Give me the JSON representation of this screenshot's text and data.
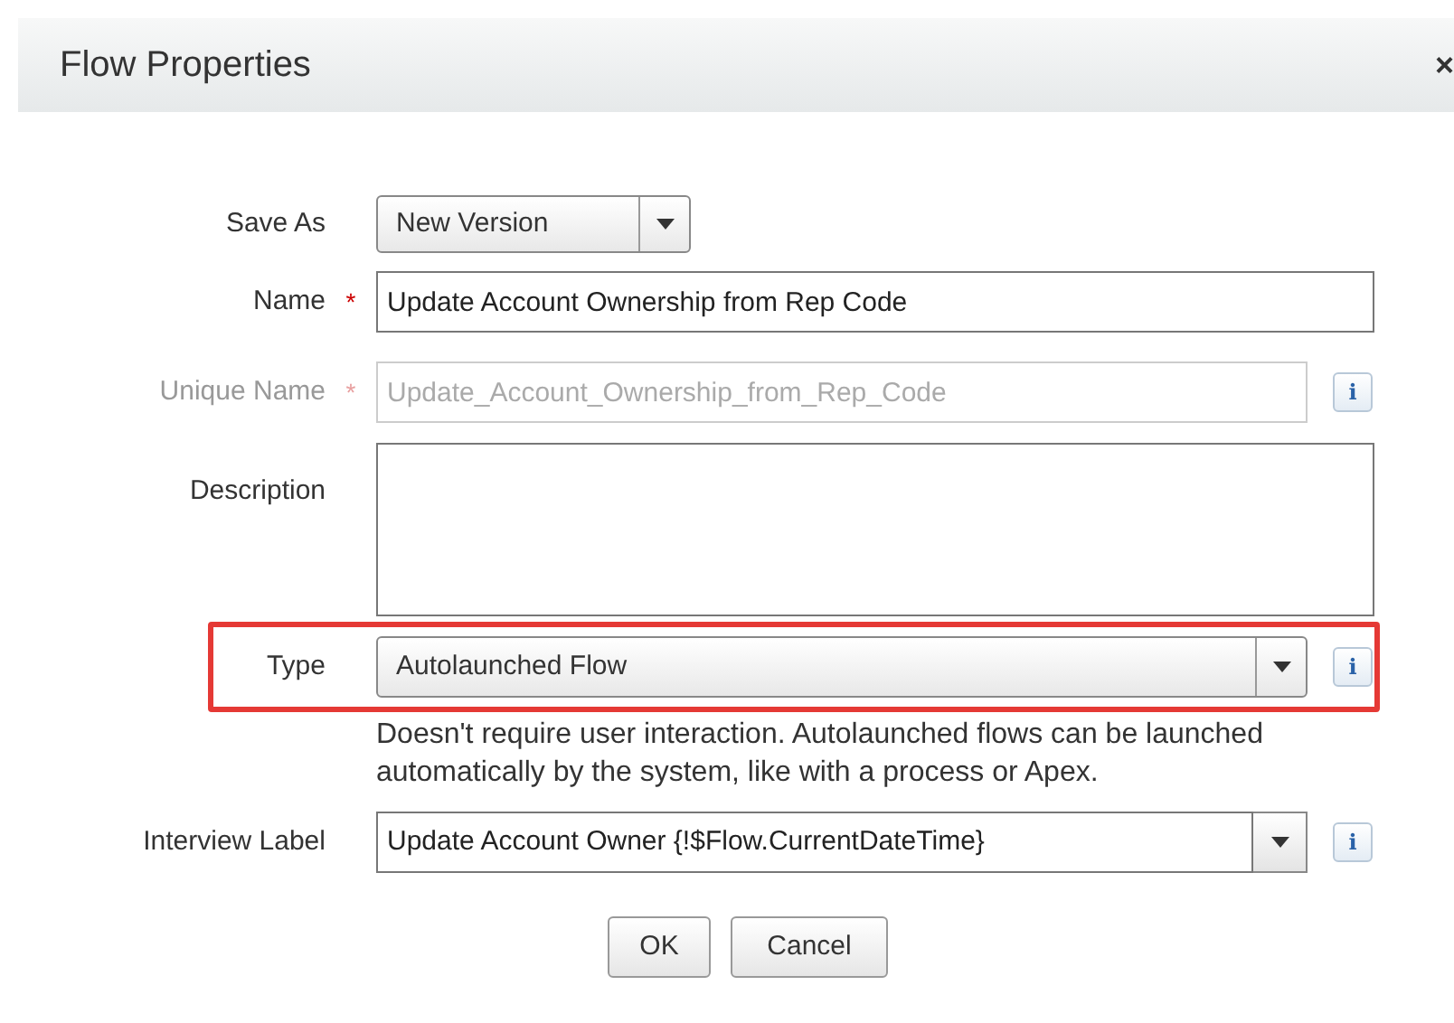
{
  "dialog": {
    "title": "Flow Properties",
    "close": "×"
  },
  "save_as": {
    "label": "Save As",
    "value": "New Version"
  },
  "name": {
    "label": "Name",
    "required_mark": "*",
    "value": "Update Account Ownership from Rep Code"
  },
  "unique_name": {
    "label": "Unique Name",
    "required_mark": "*",
    "disabled": true,
    "value": "Update_Account_Ownership_from_Rep_Code",
    "info": "i"
  },
  "description": {
    "label": "Description"
  },
  "type": {
    "label": "Type",
    "value": "Autolaunched Flow",
    "info": "i",
    "highlighted": true,
    "help": "Doesn't require user interaction. Autolaunched flows can be launched automatically by the system, like with a process or Apex."
  },
  "interview_label": {
    "label": "Interview Label",
    "value": "Update Account Owner {!$Flow.CurrentDateTime}",
    "info": "i"
  },
  "buttons": [
    "OK",
    "Cancel"
  ]
}
